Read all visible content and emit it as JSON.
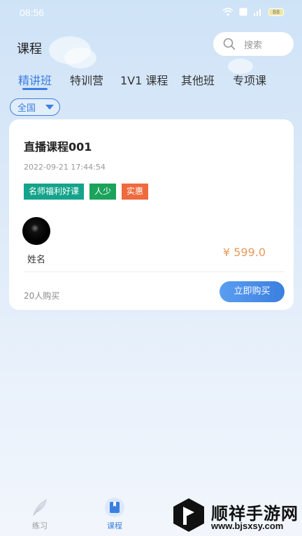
{
  "status_bar": {
    "time": "08:56",
    "icons": [
      "wifi-icon",
      "hd-icon",
      "signal-icon",
      "battery-icon"
    ],
    "battery": "88"
  },
  "header": {
    "title": "课程",
    "search": {
      "placeholder": "搜索",
      "icon": "search-icon"
    }
  },
  "tabs": [
    {
      "label": "精讲班",
      "active": true
    },
    {
      "label": "特训营",
      "active": false
    },
    {
      "label": "1V1 课程",
      "active": false
    },
    {
      "label": "其他班",
      "active": false
    },
    {
      "label": "专项课",
      "active": false
    }
  ],
  "filter": {
    "region": "全国"
  },
  "course_card": {
    "title": "直播课程001",
    "datetime": "2022-09-21 17:44:54",
    "tags": [
      {
        "label": "名师福利好课",
        "color": "#14a38b"
      },
      {
        "label": "人少",
        "color": "#1aa35a"
      },
      {
        "label": "实惠",
        "color": "#ef6a3d"
      }
    ],
    "teacher_name": "姓名",
    "price": "¥ 599.0",
    "buyers": "20人购买",
    "buy_label": "立即购买"
  },
  "bottom_nav": [
    {
      "label": "练习",
      "icon": "feather-icon",
      "active": false
    },
    {
      "label": "课程",
      "icon": "book-icon",
      "active": true
    }
  ],
  "watermark": {
    "text": "顺祥手游网",
    "url": "www.bjsxsy.com"
  },
  "colors": {
    "accent": "#3b7fe0",
    "price": "#e89a5b"
  }
}
